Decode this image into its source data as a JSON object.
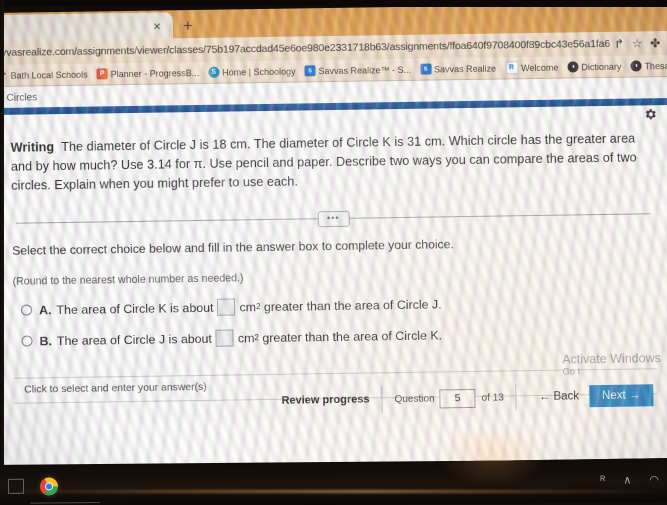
{
  "browser": {
    "tab_close_glyph": "×",
    "new_tab_glyph": "+",
    "url": "iavvasrealize.com/assignments/viewer/classes/75b197accdad45e6oe980e2331718b63/assignments/ffoa640f9708400f89cbc43e56a1fa66/co...",
    "share_glyph": "↱",
    "star_glyph": "☆",
    "extension_glyph": "✤",
    "bookmarks": [
      {
        "label": "Bath Local Schools",
        "icon": "bath-schools-icon",
        "icon_class": "ic-bath",
        "glyph": "⚘"
      },
      {
        "label": "Planner - ProgressB...",
        "icon": "planner-icon",
        "icon_class": "ic-plan",
        "glyph": "P"
      },
      {
        "label": "Home | Schoology",
        "icon": "schoology-icon",
        "icon_class": "ic-schoo",
        "glyph": "S"
      },
      {
        "label": "Savvas Realize™ - S...",
        "icon": "savvas-realize-icon",
        "icon_class": "ic-savvas",
        "glyph": "s"
      },
      {
        "label": "Savvas Realize",
        "icon": "savvas-realize-icon",
        "icon_class": "ic-savvas",
        "glyph": "s"
      },
      {
        "label": "Welcome",
        "icon": "welcome-icon",
        "icon_class": "ic-welc",
        "glyph": "R"
      },
      {
        "label": "Dictionary",
        "icon": "dictionary-icon",
        "icon_class": "ic-dict",
        "glyph": "◑"
      },
      {
        "label": "Thesaurus",
        "icon": "thesaurus-icon",
        "icon_class": "ic-dict",
        "glyph": "◑"
      }
    ]
  },
  "page": {
    "breadcrumb": "ı of Circles",
    "settings_icon": "gear-icon",
    "question": {
      "tag": "Writing",
      "line1": "The diameter of Circle J is 18 cm. The diameter of Circle K is 31 cm. Which circle has the",
      "line2": "greater area and by how much? Use 3.14 for π. Use pencil and paper. Describe two ways you can",
      "line3": "compare the areas of two circles. Explain when you might prefer to use each."
    },
    "expand_dots": "•••",
    "instruction": "Select the correct choice below and fill in the answer box to complete your choice.",
    "rounding_note": "(Round to the nearest whole number as needed.)",
    "choices": [
      {
        "letter": "A.",
        "text_before": "The area of Circle K is about",
        "unit": "cm",
        "exponent": "2",
        "text_after": "greater than the area of Circle J.",
        "answer_value": "",
        "selected": false
      },
      {
        "letter": "B.",
        "text_before": "The area of Circle J is about",
        "unit": "cm",
        "exponent": "2",
        "text_after": "greater than the area of Circle K.",
        "answer_value": "",
        "selected": false
      }
    ],
    "hint": "Click to select and enter your answer(s)",
    "footer": {
      "review_progress": "Review progress",
      "question_label": "Question",
      "question_number": "5",
      "of_label": "of 13",
      "back_label": "← Back",
      "next_label": "Next →",
      "next_color": "#1580c8"
    }
  },
  "watermark": {
    "line1": "Activate Windows",
    "line2": "Go t"
  },
  "taskbar": {
    "start_icon": "start-menu-icon",
    "chrome_icon": "chrome-icon",
    "tray": [
      {
        "icon": "ime-language-icon",
        "glyph": "ᴿ"
      },
      {
        "icon": "show-hidden-icons-chevron",
        "glyph": "∧"
      },
      {
        "icon": "wifi-icon",
        "glyph": "◠"
      }
    ]
  }
}
